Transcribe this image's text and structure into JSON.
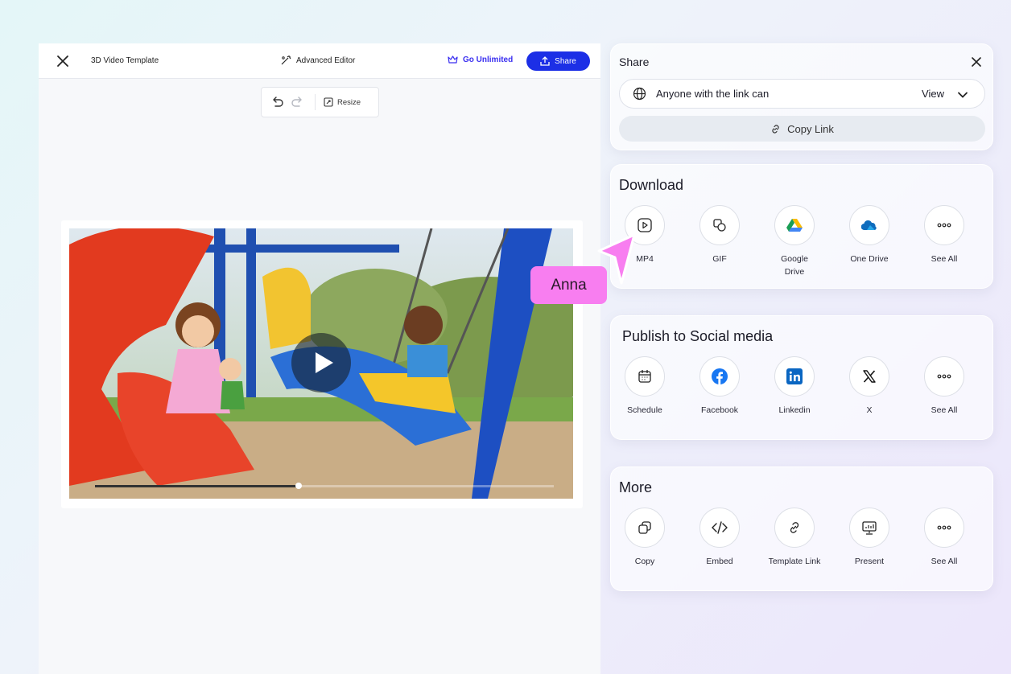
{
  "editor": {
    "title": "3D Video Template",
    "advanced_editor_label": "Advanced Editor",
    "go_unlimited_label": "Go Unlimited",
    "share_label": "Share",
    "resize_label": "Resize",
    "video": {
      "progress": 0.45
    }
  },
  "share_card": {
    "title": "Share",
    "permission_text": "Anyone with the link can",
    "permission_value": "View",
    "copy_link_label": "Copy Link"
  },
  "download": {
    "title": "Download",
    "items": [
      {
        "label": "MP4",
        "icon": "video-play-icon"
      },
      {
        "label": "GIF",
        "icon": "gif-icon"
      },
      {
        "label": "Google\nDrive",
        "icon": "google-drive-icon"
      },
      {
        "label": "One Drive",
        "icon": "onedrive-icon"
      },
      {
        "label": "See All",
        "icon": "more-icon"
      }
    ]
  },
  "social": {
    "title": "Publish to Social media",
    "items": [
      {
        "label": "Schedule",
        "icon": "calendar-icon"
      },
      {
        "label": "Facebook",
        "icon": "facebook-icon"
      },
      {
        "label": "Linkedin",
        "icon": "linkedin-icon"
      },
      {
        "label": "X",
        "icon": "x-icon"
      },
      {
        "label": "See All",
        "icon": "more-icon"
      }
    ]
  },
  "more": {
    "title": "More",
    "items": [
      {
        "label": "Copy",
        "icon": "copy-icon"
      },
      {
        "label": "Embed",
        "icon": "code-icon"
      },
      {
        "label": "Template Link",
        "icon": "link-icon"
      },
      {
        "label": "Present",
        "icon": "presentation-icon"
      },
      {
        "label": "See All",
        "icon": "more-icon"
      }
    ]
  },
  "collaborator": {
    "name": "Anna",
    "color": "#f87ef0"
  },
  "colors": {
    "primary": "#1c2fe6",
    "accent": "#3a2ff0",
    "facebook": "#1877f2",
    "linkedin": "#0a66c2"
  }
}
